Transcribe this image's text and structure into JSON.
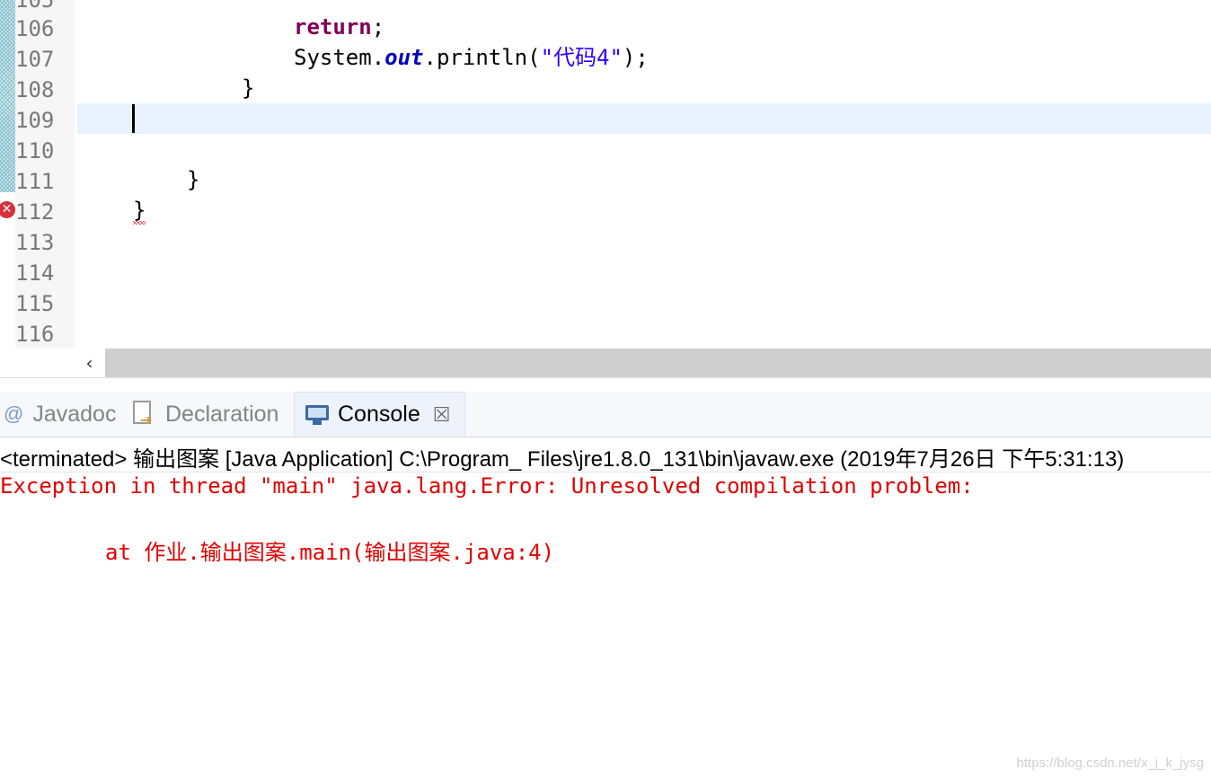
{
  "editor": {
    "partial_top_line": "105",
    "line_numbers": [
      "106",
      "107",
      "108",
      "109",
      "110",
      "111",
      "112",
      "113",
      "114",
      "115",
      "116"
    ],
    "code": {
      "l106_kw": "return",
      "l106_rest": ";",
      "l107_a": "System.",
      "l107_field": "out",
      "l107_b": ".println(",
      "l107_str": "\"代码4\"",
      "l107_c": ");",
      "l108": "}",
      "l111": "}",
      "l112": "}"
    },
    "error_marker_line": "112"
  },
  "tabs": {
    "javadoc": {
      "icon": "@",
      "label": "Javadoc"
    },
    "declaration": {
      "label": "Declaration"
    },
    "console": {
      "label": "Console",
      "close": "☒"
    }
  },
  "console": {
    "header": "<terminated> 输出图案 [Java Application] C:\\Program_ Files\\jre1.8.0_131\\bin\\javaw.exe (2019年7月26日 下午5:31:13)",
    "lines": [
      "Exception in thread \"main\" java.lang.Error: Unresolved compilation problem: ",
      "",
      "\tat 作业.输出图案.main(输出图案.java:4)"
    ]
  },
  "watermark": "https://blog.csdn.net/x_j_k_jysg",
  "colors": {
    "keyword": "#7f0055",
    "field": "#0000c0",
    "string": "#2a00ff",
    "error_text": "#e10000",
    "current_line": "#e8f2fe"
  },
  "icons": {
    "error_marker": "error-x-icon",
    "console_tab": "monitor-icon",
    "declaration_tab": "declaration-doc-icon",
    "scroll_left": "chevron-left-icon"
  }
}
